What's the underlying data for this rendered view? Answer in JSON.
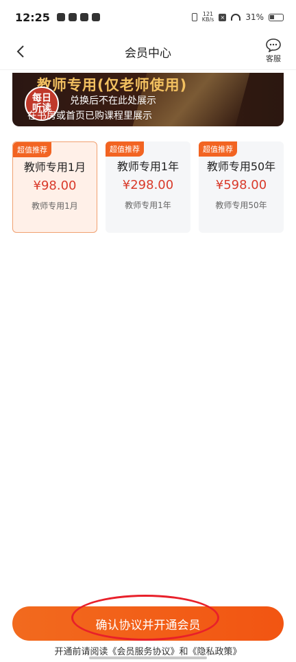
{
  "status_bar": {
    "time": "12:25",
    "net_speed_value": "121",
    "net_speed_unit": "KB/s",
    "battery": "31%"
  },
  "nav": {
    "title": "会员中心",
    "service_label": "客服"
  },
  "banner": {
    "title": "教师专用(仅老师使用)",
    "badge": "每日听读",
    "line1": "兑换后不在此处展示",
    "line2": "在书房或首页已购课程里展示"
  },
  "plans": [
    {
      "tag": "超值推荐",
      "name": "教师专用1月",
      "price": "¥98.00",
      "desc": "教师专用1月",
      "selected": true
    },
    {
      "tag": "超值推荐",
      "name": "教师专用1年",
      "price": "¥298.00",
      "desc": "教师专用1年",
      "selected": false
    },
    {
      "tag": "超值推荐",
      "name": "教师专用50年",
      "price": "¥598.00",
      "desc": "教师专用50年",
      "selected": false
    }
  ],
  "cta": {
    "label": "确认协议并开通会员"
  },
  "agreement": {
    "prefix": "开通前请阅读",
    "service_link": "《会员服务协议》",
    "and": "和",
    "privacy_link": "《隐私政策》"
  },
  "colors": {
    "accent": "#f26422",
    "price": "#d93a2a",
    "banner_title": "#f2c060",
    "highlight_circle": "#e8202a"
  }
}
